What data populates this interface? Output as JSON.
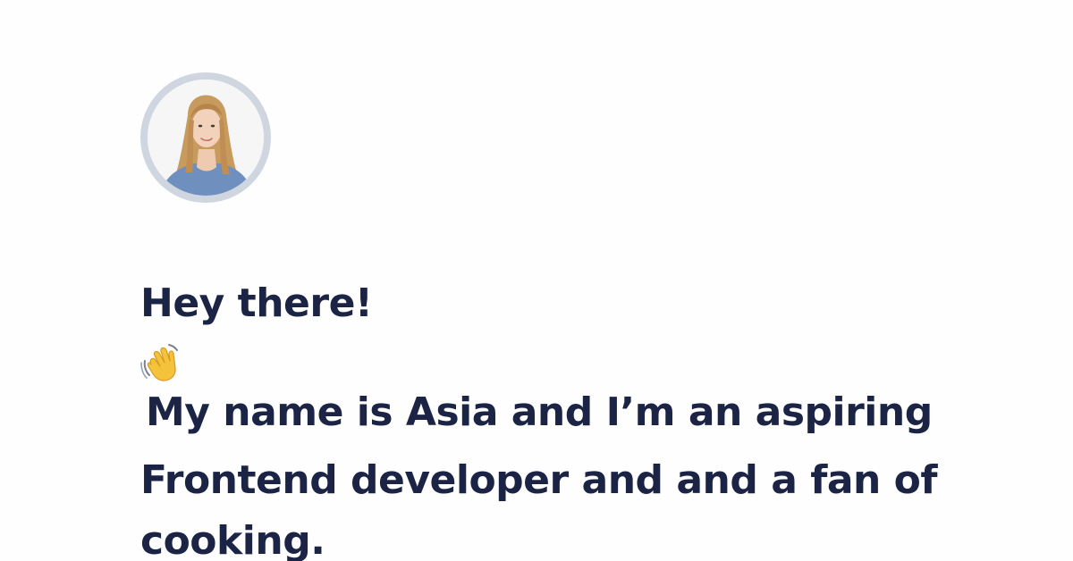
{
  "profile": {
    "avatar_icon": "profile-photo",
    "ring_color": "#cfd6df"
  },
  "intro": {
    "before_emoji": "Hey there!",
    "emoji_icon": "waving-hand-icon",
    "after_emoji": "My name is Asia and I’m an aspiring Frontend developer and and a fan of cooking."
  },
  "colors": {
    "text": "#1c2445",
    "background": "#fefefe"
  }
}
